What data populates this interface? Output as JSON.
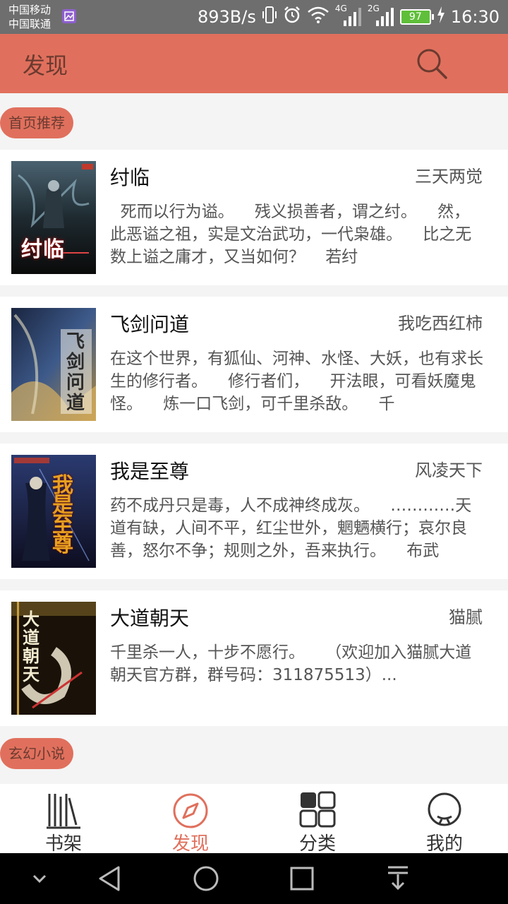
{
  "status_bar": {
    "carrier_1": "中国移动",
    "carrier_2": "中国联通",
    "speed": "893B/s",
    "net_4g": "4G",
    "net_2g": "2G",
    "battery": "97",
    "time": "16:30"
  },
  "header": {
    "title": "发现"
  },
  "sections": [
    {
      "label": "首页推荐"
    },
    {
      "label": "玄幻小说"
    }
  ],
  "books": [
    {
      "title": "纣临",
      "author": "三天两觉",
      "description": "  死而以行为谥。    残义损善者，谓之纣。    然，此恶谥之祖，实是文治武功，一代枭雄。    比之无数上谥之庸才，又当如何？    若纣",
      "cover_text": "纣临"
    },
    {
      "title": "飞剑问道",
      "author": "我吃西红柿",
      "description": "在这个世界，有狐仙、河神、水怪、大妖，也有求长生的修行者。    修行者们，    开法眼，可看妖魔鬼怪。    炼一口飞剑，可千里杀敌。    千",
      "cover_text": "飞剑问道"
    },
    {
      "title": "我是至尊",
      "author": "风凌天下",
      "description": "药不成丹只是毒，人不成神终成灰。    …………天道有缺，人间不平，红尘世外，魍魉横行；哀尔良善，怒尔不争；规则之外，吾来执行。    布武",
      "cover_text": "我是至尊"
    },
    {
      "title": "大道朝天",
      "author": "猫腻",
      "description": "千里杀一人，十步不愿行。    （欢迎加入猫腻大道朝天官方群，群号码：311875513）...",
      "cover_text": "大道朝天"
    }
  ],
  "bottom_nav": [
    {
      "label": "书架",
      "icon": "bookshelf-icon"
    },
    {
      "label": "发现",
      "icon": "compass-icon",
      "active": true
    },
    {
      "label": "分类",
      "icon": "grid-icon"
    },
    {
      "label": "我的",
      "icon": "user-icon"
    }
  ],
  "colors": {
    "accent": "#e0705d",
    "status_bar": "#6e6e6e"
  }
}
